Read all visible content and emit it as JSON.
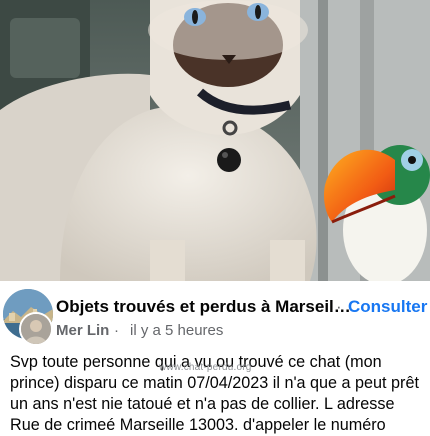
{
  "post": {
    "group_name": "Objets trouvés et perdus à Marseil…",
    "separator": "·",
    "follow_label": "Consulter",
    "author": "Mer Lin",
    "meta_separator": "·",
    "time": "il y a 5 heures",
    "text": "Svp toute personne qui a vu ou trouvé ce chat (mon prince) disparu ce matin 07/04/2023 il n'a que a peut prêt un ans n'est nie tatoué et n'a pas de collier. L adresse Rue de crimeé Marseille 13003. d'appeler le numéro",
    "watermark": "www.chat-perdu.org"
  },
  "colors": {
    "link_blue": "#1877f2",
    "meta_gray": "#65676b",
    "text": "#050505"
  }
}
